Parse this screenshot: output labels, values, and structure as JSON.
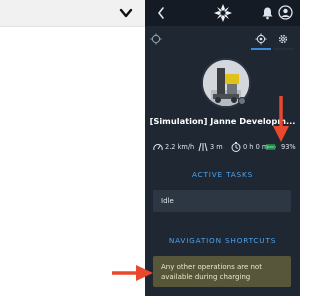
{
  "robot": {
    "name": "[Simulation] Janne Developm...",
    "status_dot": "#6c7480"
  },
  "stats": {
    "speed": "2.2 km/h",
    "distance": "3 m",
    "time": "0 h 0 m",
    "battery": "93%"
  },
  "sections": {
    "active_tasks_title": "ACTIVE TASKS",
    "active_task": "Idle",
    "nav_shortcuts_title": "NAVIGATION SHORTCUTS"
  },
  "notice": {
    "text": "Any other operations are not available during charging"
  },
  "colors": {
    "panel_bg": "#1f2733",
    "accent": "#4da3f0",
    "annotation_arrow": "#e8482c",
    "battery_green": "#3cc36a"
  },
  "icons": [
    "chevron-down-icon",
    "back-icon",
    "logo-icon",
    "bell-icon",
    "user-icon",
    "target-icon",
    "locate-icon",
    "settings-icon",
    "speedometer-icon",
    "distance-icon",
    "clock-icon",
    "battery-icon"
  ]
}
